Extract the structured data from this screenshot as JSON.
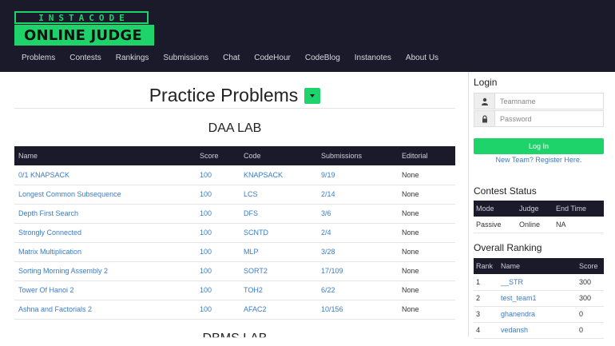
{
  "logo": {
    "top": "INSTACODE",
    "bottom": "ONLINE JUDGE"
  },
  "nav": [
    "Problems",
    "Contests",
    "Rankings",
    "Submissions",
    "Chat",
    "CodeHour",
    "CodeBlog",
    "Instanotes",
    "About Us"
  ],
  "main": {
    "title": "Practice Problems",
    "section": "DAA LAB",
    "next_section": "DBMS LAB",
    "columns": [
      "Name",
      "Score",
      "Code",
      "Submissions",
      "Editorial"
    ],
    "rows": [
      {
        "name": "0/1 KNAPSACK",
        "score": "100",
        "code": "KNAPSACK",
        "submissions": "9/19",
        "editorial": "None"
      },
      {
        "name": "Longest Common Subsequence",
        "score": "100",
        "code": "LCS",
        "submissions": "2/14",
        "editorial": "None"
      },
      {
        "name": "Depth First Search",
        "score": "100",
        "code": "DFS",
        "submissions": "3/6",
        "editorial": "None"
      },
      {
        "name": "Strongly Connected",
        "score": "100",
        "code": "SCNTD",
        "submissions": "2/4",
        "editorial": "None"
      },
      {
        "name": "Matrix Multiplication",
        "score": "100",
        "code": "MLP",
        "submissions": "3/28",
        "editorial": "None"
      },
      {
        "name": "Sorting Morning Assembly 2",
        "score": "100",
        "code": "SORT2",
        "submissions": "17/109",
        "editorial": "None"
      },
      {
        "name": "Tower Of Hanoi 2",
        "score": "100",
        "code": "TOH2",
        "submissions": "6/22",
        "editorial": "None"
      },
      {
        "name": "Ashna and Factorials 2",
        "score": "100",
        "code": "AFAC2",
        "submissions": "10/156",
        "editorial": "None"
      }
    ]
  },
  "sidebar": {
    "login_title": "Login",
    "teamname_placeholder": "Teamname",
    "password_placeholder": "Password",
    "login_button": "Log In",
    "register_link": "New Team? Register Here.",
    "contest_title": "Contest Status",
    "contest_columns": [
      "Mode",
      "Judge",
      "End Time"
    ],
    "contest_row": [
      "Passive",
      "Online",
      "NA"
    ],
    "ranking_title": "Overall Ranking",
    "ranking_columns": [
      "Rank",
      "Name",
      "Score"
    ],
    "ranking_rows": [
      {
        "rank": "1",
        "name": "__STR",
        "score": "300"
      },
      {
        "rank": "2",
        "name": "test_team1",
        "score": "300"
      },
      {
        "rank": "3",
        "name": "ghanendra",
        "score": "0"
      },
      {
        "rank": "4",
        "name": "vedansh",
        "score": "0"
      }
    ]
  },
  "colors": {
    "accent": "#1fd36b",
    "header_bg": "#1b1a2b",
    "link": "#3a7cc6"
  },
  "icons": {
    "teamname": "user-icon",
    "password": "lock-icon",
    "dropdown": "caret-down-icon"
  }
}
